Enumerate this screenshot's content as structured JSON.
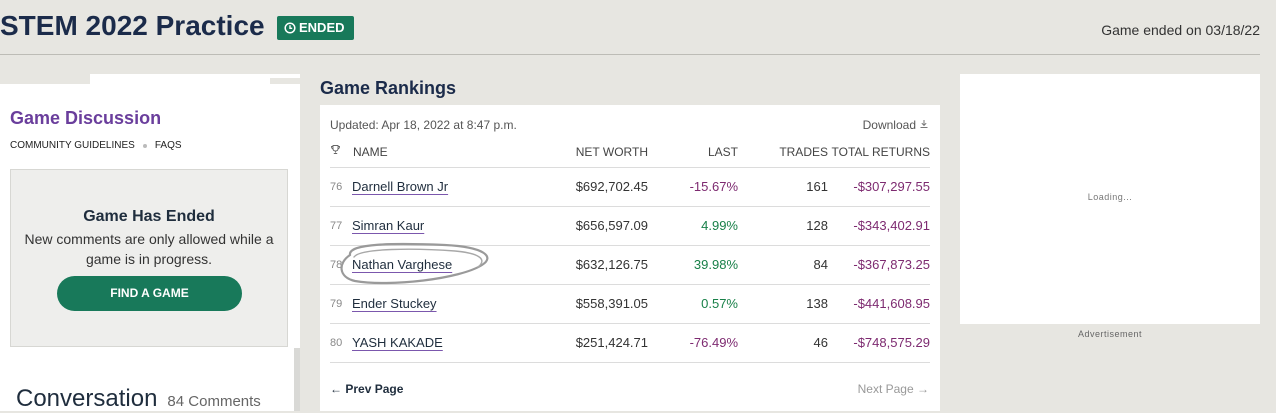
{
  "header": {
    "title": "STEM 2022 Practice",
    "status_badge": "ENDED",
    "ended_on": "Game ended on 03/18/22"
  },
  "discussion": {
    "title": "Game Discussion",
    "links": [
      "COMMUNITY GUIDELINES",
      "FAQS"
    ],
    "ended_box": {
      "title": "Game Has Ended",
      "body": "New comments are only allowed while a game is in progress.",
      "button": "FIND A GAME"
    },
    "conversation_title": "Conversation",
    "comment_count": "84 Comments"
  },
  "rankings": {
    "heading": "Game Rankings",
    "updated": "Updated: Apr 18, 2022 at 8:47 p.m.",
    "download": "Download",
    "columns": {
      "name": "NAME",
      "net_worth": "NET WORTH",
      "last": "LAST",
      "trades": "TRADES",
      "total_returns": "TOTAL RETURNS"
    },
    "rows": [
      {
        "rank": "76",
        "name": "Darnell Brown Jr",
        "net_worth": "$692,702.45",
        "last": "-15.67%",
        "trades": "161",
        "total_returns": "-$307,297.55"
      },
      {
        "rank": "77",
        "name": "Simran Kaur",
        "net_worth": "$656,597.09",
        "last": "4.99%",
        "trades": "128",
        "total_returns": "-$343,402.91"
      },
      {
        "rank": "78",
        "name": "Nathan Varghese",
        "net_worth": "$632,126.75",
        "last": "39.98%",
        "trades": "84",
        "total_returns": "-$367,873.25"
      },
      {
        "rank": "79",
        "name": "Ender Stuckey",
        "net_worth": "$558,391.05",
        "last": "0.57%",
        "trades": "138",
        "total_returns": "-$441,608.95"
      },
      {
        "rank": "80",
        "name": "YASH KAKADE",
        "net_worth": "$251,424.71",
        "last": "-76.49%",
        "trades": "46",
        "total_returns": "-$748,575.29"
      }
    ],
    "prev_page": "Prev Page",
    "next_page": "Next Page"
  },
  "ad": {
    "loading": "Loading...",
    "label": "Advertisement"
  },
  "colors": {
    "brand_green": "#18795a",
    "navy": "#1b2b4a",
    "purple": "#6a3e9c",
    "positive": "#188048",
    "negative": "#7d2a70"
  }
}
